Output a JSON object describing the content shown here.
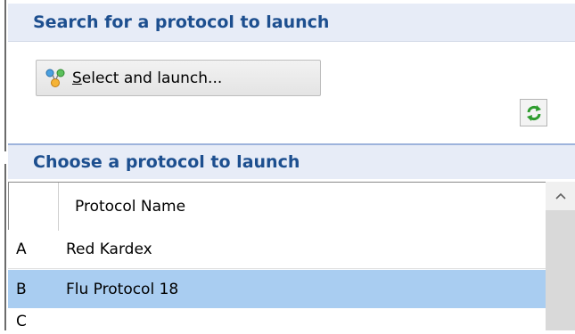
{
  "search_section": {
    "title": "Search for a protocol to launch",
    "launch_button": {
      "mnemonic": "S",
      "label_rest": "elect and launch..."
    }
  },
  "choose_section": {
    "title": "Choose a protocol to launch",
    "table": {
      "column_header": "Protocol Name",
      "rows": [
        {
          "letter": "A",
          "name": "Red Kardex",
          "selected": false
        },
        {
          "letter": "B",
          "name": "Flu Protocol 18",
          "selected": true
        },
        {
          "letter": "C",
          "name": "",
          "selected": false
        }
      ]
    }
  },
  "colors": {
    "section_header_bg": "#e7ecf7",
    "section_header_text": "#1d4f8f",
    "selected_row": "#a9cdf1"
  },
  "icons": [
    "protocol-nodes-icon",
    "refresh-icon",
    "scroll-up-icon"
  ]
}
